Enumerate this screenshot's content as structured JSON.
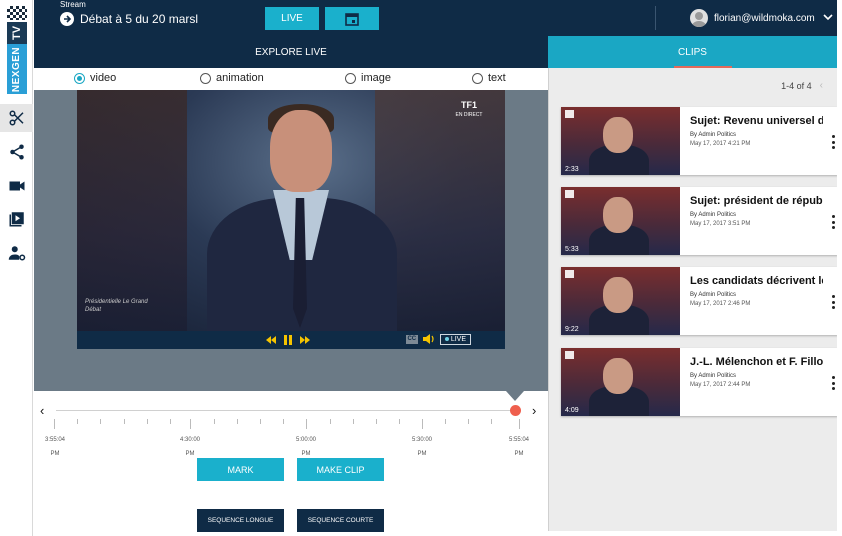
{
  "logo": {
    "brand": "NEXGEN",
    "suffix": "TV"
  },
  "rail": [
    {
      "name": "scissors-icon",
      "active": true
    },
    {
      "name": "share-icon",
      "active": false
    },
    {
      "name": "camera-icon",
      "active": false
    },
    {
      "name": "playlist-icon",
      "active": false
    },
    {
      "name": "user-settings-icon",
      "active": false
    }
  ],
  "topbar": {
    "stream_label": "Stream",
    "stream_value": "Débat à 5 du 20 marsl",
    "live_label": "LIVE",
    "user_email": "florian@wildmoka.com"
  },
  "explore": {
    "title": "EXPLORE LIVE"
  },
  "clips_tab": {
    "title": "CLIPS"
  },
  "media_types": [
    {
      "label": "video",
      "checked": true
    },
    {
      "label": "animation",
      "checked": false
    },
    {
      "label": "image",
      "checked": false
    },
    {
      "label": "text",
      "checked": false
    }
  ],
  "video": {
    "channel": "TF1",
    "channel_sub": "EN DIRECT",
    "watermark": "Présidentielle Le Grand Débat",
    "live_badge": "LIVE",
    "cc": "CC"
  },
  "timeline": {
    "ticks": [
      {
        "time": "3:55:04",
        "ampm": "PM"
      },
      {
        "time": "4:30:00",
        "ampm": "PM"
      },
      {
        "time": "5:00:00",
        "ampm": "PM"
      },
      {
        "time": "5:30:00",
        "ampm": "PM"
      },
      {
        "time": "5:55:04",
        "ampm": "PM"
      }
    ]
  },
  "actions": {
    "mark": "MARK",
    "make_clip": "MAKE CLIP",
    "seq_long": "SEQUENCE LONGUE",
    "seq_short": "SEQUENCE COURTE"
  },
  "pager": {
    "text": "1-4 of 4"
  },
  "clips": [
    {
      "title": "Sujet: Revenu universel d'",
      "author": "By Admin Politics",
      "date": "May 17, 2017 4:21 PM",
      "duration": "2:33"
    },
    {
      "title": "Sujet: président de républ",
      "author": "By Admin Politics",
      "date": "May 17, 2017 3:51 PM",
      "duration": "5:33"
    },
    {
      "title": "Les candidats décrivent le",
      "author": "By Admin Politics",
      "date": "May 17, 2017 2:46 PM",
      "duration": "9:22"
    },
    {
      "title": "J.-L. Mélenchon et F. Fillor",
      "author": "By Admin Politics",
      "date": "May 17, 2017 2:44 PM",
      "duration": "4:09"
    }
  ],
  "colors": {
    "navy": "#0f2b46",
    "accent": "#1ab0cc",
    "marker": "#ef5f4d"
  }
}
